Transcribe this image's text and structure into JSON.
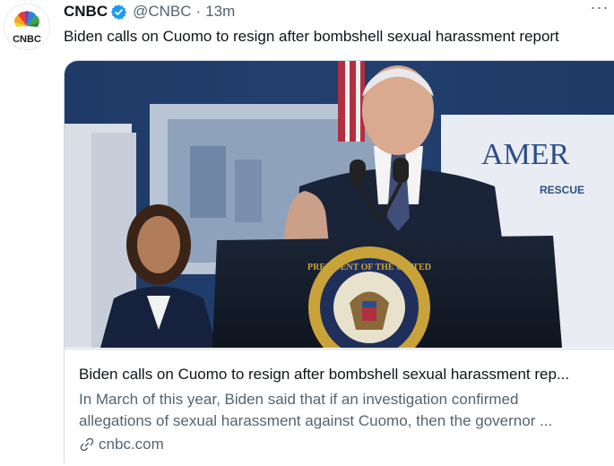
{
  "tweet": {
    "author_name": "CNBC",
    "handle": "@CNBC",
    "separator": "·",
    "time": "13m",
    "more": "···",
    "text": "Biden calls on Cuomo to resign after bombshell sexual harassment report"
  },
  "avatar": {
    "logo_text": "CNBC"
  },
  "card": {
    "image_sign_line1": "AMER",
    "image_sign_line2": "RESCUE",
    "image_seal_text": "PRESIDENT OF THE UNITED",
    "title": "Biden calls on Cuomo to resign after bombshell sexual harassment rep...",
    "description_line1": "In March of this year, Biden said that if an investigation confirmed",
    "description_line2": "allegations of sexual harassment against Cuomo, then the governor ...",
    "domain": "cnbc.com"
  },
  "colors": {
    "verified": "#1d9bf0",
    "secondary_text": "#536471",
    "border": "#cfd9de"
  },
  "icons": [
    "verified-badge-icon",
    "more-options-icon",
    "link-icon"
  ]
}
